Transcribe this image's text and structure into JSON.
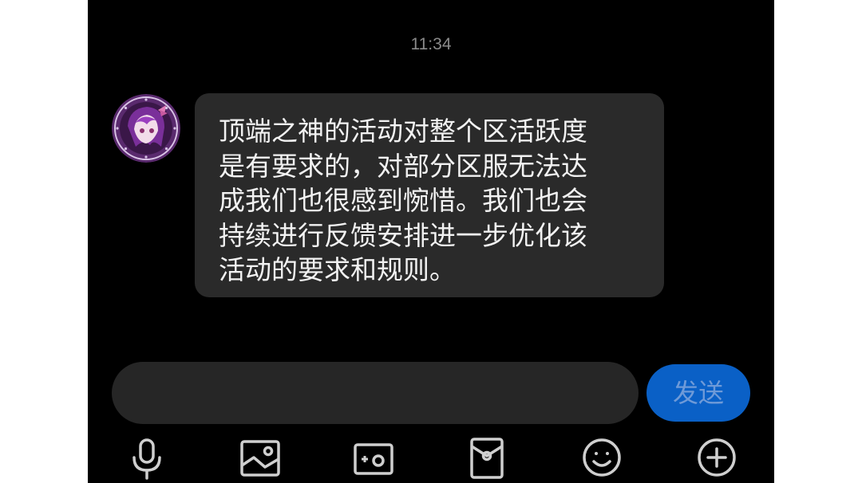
{
  "chat": {
    "timestamp": "11:34",
    "message_lines": [
      "顶端之神的活动对整个区活跃度",
      "是有要求的，对部分区服无法达",
      "成我们也很感到惋惜。我们也会",
      "持续进行反馈安排进一步优化该",
      "活动的要求和规则。"
    ],
    "avatar": "purple-anime-character-avatar"
  },
  "input": {
    "value": "",
    "send_label": "发送"
  },
  "toolbar": {
    "icons": [
      "microphone-icon",
      "image-icon",
      "camera-icon",
      "red-packet-icon",
      "emoji-icon",
      "plus-icon"
    ]
  },
  "colors": {
    "background": "#000000",
    "bubble": "#2a2a2a",
    "send_button": "#0a60c6",
    "send_text": "#6e9ad8",
    "icon": "#cfcfcf"
  }
}
